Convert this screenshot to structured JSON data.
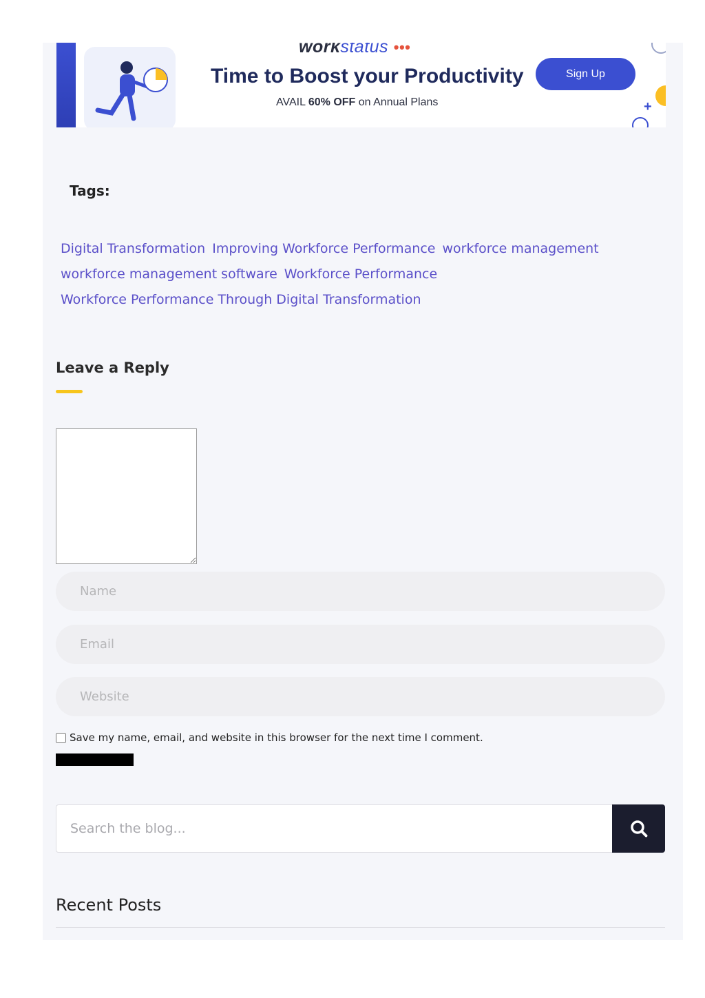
{
  "banner": {
    "logo_work": "work",
    "logo_status": "status",
    "logo_dots": "•••",
    "headline": "Time to Boost your Productivity",
    "subline_prefix": "AVAIL ",
    "subline_bold": "60% OFF",
    "subline_suffix": " on Annual Plans",
    "signup_label": "Sign Up",
    "colors": {
      "accent": "#3b4fd1",
      "yellow": "#fbbf24"
    }
  },
  "tags": {
    "label": "Tags:",
    "rows": [
      [
        "Digital Transformation",
        "Improving Workforce Performance",
        "workforce management"
      ],
      [
        "workforce management software",
        "Workforce Performance"
      ],
      [
        "Workforce Performance Through Digital Transformation"
      ]
    ],
    "color": "#5b50c9"
  },
  "reply": {
    "title": "Leave a Reply",
    "name_placeholder": "Name",
    "email_placeholder": "Email",
    "website_placeholder": "Website",
    "save_label": "Save my name, email, and website in this browser for the next time I comment."
  },
  "search": {
    "placeholder": "Search the blog...",
    "icon": "search-icon"
  },
  "recent_posts": {
    "title": "Recent Posts"
  }
}
